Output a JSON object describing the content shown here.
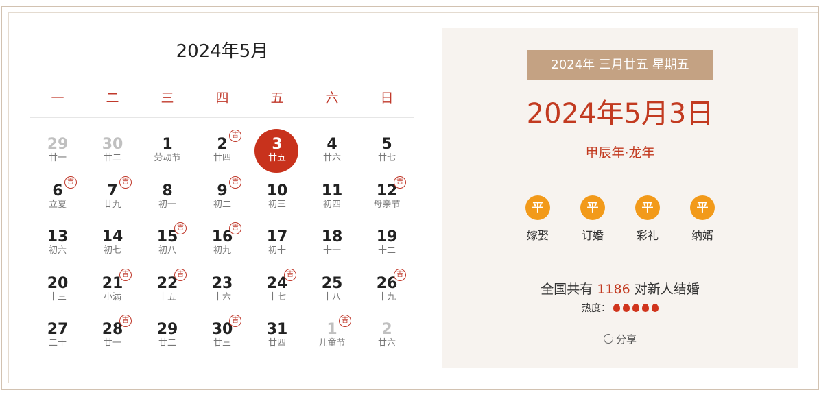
{
  "calendar": {
    "title": "2024年5月",
    "weekdays": [
      "一",
      "二",
      "三",
      "四",
      "五",
      "六",
      "日"
    ],
    "badge_text": "吉",
    "weeks": [
      [
        {
          "day": "29",
          "lunar": "廿一",
          "other": true,
          "ji": false
        },
        {
          "day": "30",
          "lunar": "廿二",
          "other": true,
          "ji": false
        },
        {
          "day": "1",
          "lunar": "劳动节",
          "other": false,
          "ji": false
        },
        {
          "day": "2",
          "lunar": "廿四",
          "other": false,
          "ji": true
        },
        {
          "day": "3",
          "lunar": "廿五",
          "other": false,
          "ji": false,
          "selected": true
        },
        {
          "day": "4",
          "lunar": "廿六",
          "other": false,
          "ji": false
        },
        {
          "day": "5",
          "lunar": "廿七",
          "other": false,
          "ji": false
        }
      ],
      [
        {
          "day": "6",
          "lunar": "立夏",
          "other": false,
          "ji": true
        },
        {
          "day": "7",
          "lunar": "廿九",
          "other": false,
          "ji": true
        },
        {
          "day": "8",
          "lunar": "初一",
          "other": false,
          "ji": false
        },
        {
          "day": "9",
          "lunar": "初二",
          "other": false,
          "ji": true
        },
        {
          "day": "10",
          "lunar": "初三",
          "other": false,
          "ji": false
        },
        {
          "day": "11",
          "lunar": "初四",
          "other": false,
          "ji": false
        },
        {
          "day": "12",
          "lunar": "母亲节",
          "other": false,
          "ji": true
        }
      ],
      [
        {
          "day": "13",
          "lunar": "初六",
          "other": false,
          "ji": false
        },
        {
          "day": "14",
          "lunar": "初七",
          "other": false,
          "ji": false
        },
        {
          "day": "15",
          "lunar": "初八",
          "other": false,
          "ji": true
        },
        {
          "day": "16",
          "lunar": "初九",
          "other": false,
          "ji": true
        },
        {
          "day": "17",
          "lunar": "初十",
          "other": false,
          "ji": false
        },
        {
          "day": "18",
          "lunar": "十一",
          "other": false,
          "ji": false
        },
        {
          "day": "19",
          "lunar": "十二",
          "other": false,
          "ji": false
        }
      ],
      [
        {
          "day": "20",
          "lunar": "十三",
          "other": false,
          "ji": false
        },
        {
          "day": "21",
          "lunar": "小满",
          "other": false,
          "ji": true
        },
        {
          "day": "22",
          "lunar": "十五",
          "other": false,
          "ji": true
        },
        {
          "day": "23",
          "lunar": "十六",
          "other": false,
          "ji": false
        },
        {
          "day": "24",
          "lunar": "十七",
          "other": false,
          "ji": true
        },
        {
          "day": "25",
          "lunar": "十八",
          "other": false,
          "ji": false
        },
        {
          "day": "26",
          "lunar": "十九",
          "other": false,
          "ji": true
        }
      ],
      [
        {
          "day": "27",
          "lunar": "二十",
          "other": false,
          "ji": false
        },
        {
          "day": "28",
          "lunar": "廿一",
          "other": false,
          "ji": true
        },
        {
          "day": "29",
          "lunar": "廿二",
          "other": false,
          "ji": false
        },
        {
          "day": "30",
          "lunar": "廿三",
          "other": false,
          "ji": true
        },
        {
          "day": "31",
          "lunar": "廿四",
          "other": false,
          "ji": false
        },
        {
          "day": "1",
          "lunar": "儿童节",
          "other": true,
          "ji": true
        },
        {
          "day": "2",
          "lunar": "廿六",
          "other": true,
          "ji": false
        }
      ]
    ]
  },
  "detail": {
    "lunar_banner": "2024年 三月廿五 星期五",
    "big_date": "2024年5月3日",
    "ganzhi": "甲辰年·龙年",
    "activities": [
      {
        "badge": "平",
        "label": "嫁娶"
      },
      {
        "badge": "平",
        "label": "订婚"
      },
      {
        "badge": "平",
        "label": "彩礼"
      },
      {
        "badge": "平",
        "label": "纳婿"
      }
    ],
    "stat_prefix": "全国共有",
    "stat_count": "1186",
    "stat_suffix": "对新人结婚",
    "heat_label": "热度：",
    "heat_level": 5,
    "share_label": "分享"
  },
  "colors": {
    "accent": "#c23a20",
    "banner": "#c4a283",
    "badge": "#f29a1a",
    "panel_bg": "#f7f3ef"
  }
}
